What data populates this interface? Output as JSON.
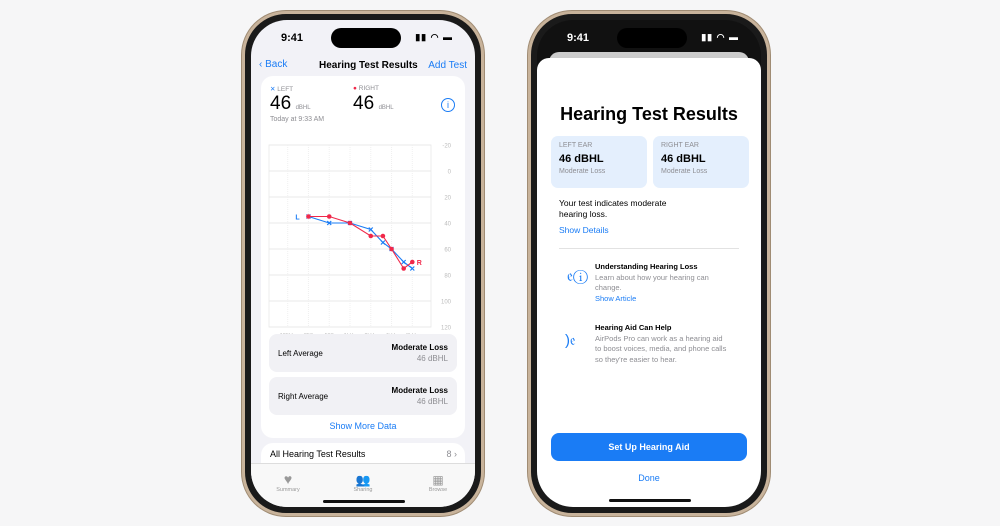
{
  "phone1": {
    "status": {
      "time": "9:41"
    },
    "nav": {
      "back": "Back",
      "title": "Hearing Test Results",
      "add": "Add Test"
    },
    "left": {
      "legend": "LEFT",
      "value": "46",
      "unit": "dBHL"
    },
    "right": {
      "legend": "RIGHT",
      "value": "46",
      "unit": "dBHL"
    },
    "timestamp": "Today at 9:33 AM",
    "left_avg": {
      "label": "Left Average",
      "category": "Moderate Loss",
      "value": "46 dBHL"
    },
    "right_avg": {
      "label": "Right Average",
      "category": "Moderate Loss",
      "value": "46 dBHL"
    },
    "show_more": "Show More Data",
    "all_results": {
      "label": "All Hearing Test Results",
      "count": "8"
    },
    "tabs": [
      {
        "label": "Summary",
        "icon": "heart-icon"
      },
      {
        "label": "Sharing",
        "icon": "people-icon"
      },
      {
        "label": "Browse",
        "icon": "grid-icon"
      }
    ]
  },
  "chart_data": {
    "type": "line",
    "x_tick_labels": [
      "125Hz",
      "250",
      "500",
      "1kHz",
      "2kHz",
      "4kHz",
      "8kHz"
    ],
    "x_ticks_hz": [
      125,
      250,
      500,
      1000,
      2000,
      4000,
      8000
    ],
    "y_ticks": [
      -20,
      0,
      20,
      40,
      60,
      80,
      100,
      120
    ],
    "ylim": [
      -20,
      120
    ],
    "y_inverted": true,
    "x_scale": "log",
    "grid": true,
    "series": [
      {
        "name": "L",
        "color": "#1a7cf5",
        "marker": "x",
        "x": [
          250,
          500,
          1000,
          2000,
          3000,
          4000,
          6000,
          8000
        ],
        "y": [
          35,
          40,
          40,
          45,
          55,
          60,
          70,
          75
        ]
      },
      {
        "name": "R",
        "color": "#f0284a",
        "marker": "dot",
        "x": [
          250,
          500,
          1000,
          2000,
          3000,
          4000,
          6000,
          8000
        ],
        "y": [
          35,
          35,
          40,
          50,
          50,
          60,
          75,
          70
        ]
      }
    ]
  },
  "phone2": {
    "status": {
      "time": "9:41"
    },
    "title": "Hearing Test Results",
    "left_ear": {
      "label": "LEFT EAR",
      "value": "46 dBHL",
      "category": "Moderate Loss"
    },
    "right_ear": {
      "label": "RIGHT EAR",
      "value": "46 dBHL",
      "category": "Moderate Loss"
    },
    "summary": "Your test indicates moderate hearing loss.",
    "show_details": "Show Details",
    "items": [
      {
        "title": "Understanding Hearing Loss",
        "body": "Learn about how your hearing can change.",
        "link": "Show Article",
        "icon": "ear-info-icon"
      },
      {
        "title": "Hearing Aid Can Help",
        "body": "AirPods Pro can work as a hearing aid to boost voices, media, and phone calls so they're easier to hear.",
        "icon": "ear-sound-icon"
      }
    ],
    "primary_button": "Set Up Hearing Aid",
    "done": "Done"
  }
}
